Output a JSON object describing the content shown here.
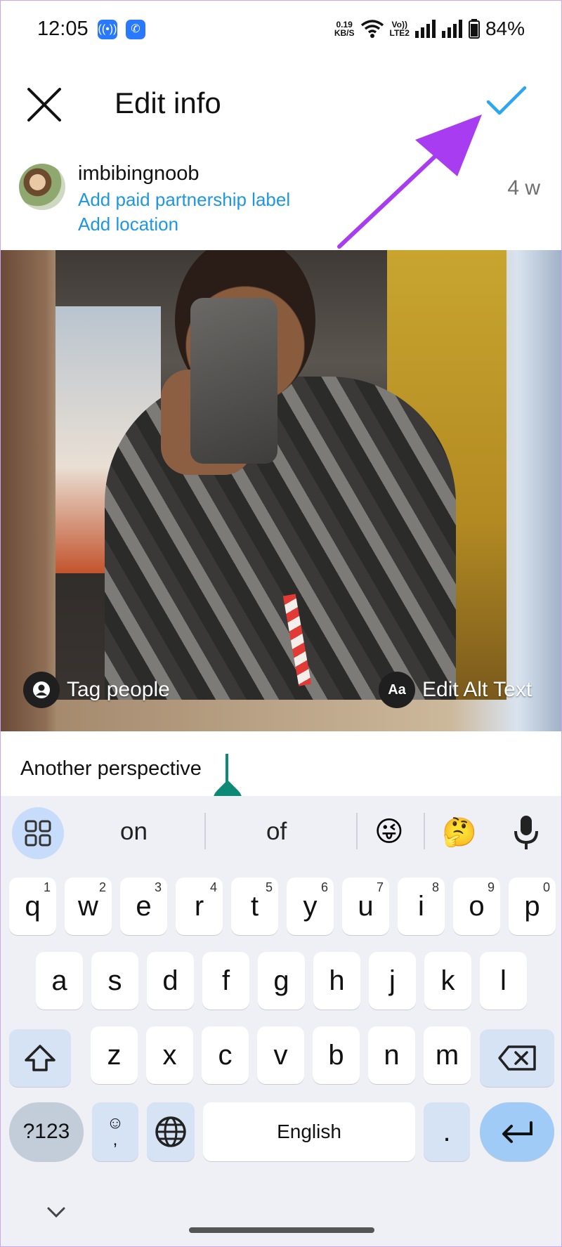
{
  "status_bar": {
    "time": "12:05",
    "net_speed_value": "0.19",
    "net_speed_unit": "KB/S",
    "volte_top": "Vo))",
    "volte_bottom": "LTE2",
    "battery": "84%"
  },
  "header": {
    "title": "Edit info"
  },
  "post": {
    "username": "imbibingnoob",
    "paid_partnership_link": "Add paid partnership label",
    "location_link": "Add location",
    "age": "4 w",
    "tag_people_label": "Tag people",
    "alt_text_icon": "Aa",
    "alt_text_label": "Edit Alt Text",
    "caption": "Another perspective"
  },
  "keyboard": {
    "suggestions": [
      "on",
      "of"
    ],
    "emoji_suggestions": [
      "😜",
      "🤔"
    ],
    "row1": [
      {
        "k": "q",
        "n": "1"
      },
      {
        "k": "w",
        "n": "2"
      },
      {
        "k": "e",
        "n": "3"
      },
      {
        "k": "r",
        "n": "4"
      },
      {
        "k": "t",
        "n": "5"
      },
      {
        "k": "y",
        "n": "6"
      },
      {
        "k": "u",
        "n": "7"
      },
      {
        "k": "i",
        "n": "8"
      },
      {
        "k": "o",
        "n": "9"
      },
      {
        "k": "p",
        "n": "0"
      }
    ],
    "row2": [
      "a",
      "s",
      "d",
      "f",
      "g",
      "h",
      "j",
      "k",
      "l"
    ],
    "row3": [
      "z",
      "x",
      "c",
      "v",
      "b",
      "n",
      "m"
    ],
    "symbols_label": "?123",
    "emoji_key_top": "☺",
    "emoji_key_bottom": ",",
    "space_label": "English",
    "period_label": "."
  },
  "colors": {
    "accent_check": "#2ba6f0",
    "link_blue": "#1f97e0",
    "arrow_purple": "#a83cf0",
    "cursor_teal": "#0d8a76",
    "keyboard_bg": "#eef0f6"
  }
}
